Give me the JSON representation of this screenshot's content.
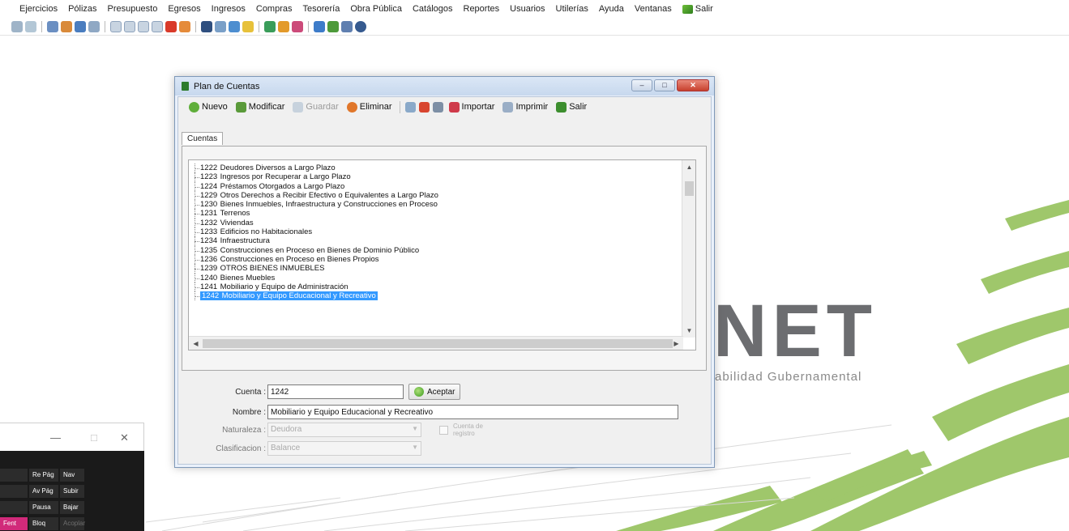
{
  "menubar": {
    "items": [
      "Ejercicios",
      "Pólizas",
      "Presupuesto",
      "Egresos",
      "Ingresos",
      "Compras",
      "Tesorería",
      "Obra Pública",
      "Catálogos",
      "Reportes",
      "Usuarios",
      "Utilerías",
      "Ayuda",
      "Ventanas"
    ],
    "exit_label": "Salir"
  },
  "background": {
    "logo_text": "NET",
    "logo_subtitle": "abilidad Gubernamental"
  },
  "dialog": {
    "title": "Plan de Cuentas",
    "toolbar": {
      "new": "Nuevo",
      "modify": "Modificar",
      "save": "Guardar",
      "delete": "Eliminar",
      "import": "Importar",
      "print": "Imprimir",
      "exit": "Salir"
    },
    "tab": "Cuentas",
    "tree": [
      {
        "code": "1222",
        "label": "Deudores Diversos a Largo Plazo"
      },
      {
        "code": "1223",
        "label": "Ingresos por Recuperar a Largo Plazo"
      },
      {
        "code": "1224",
        "label": "Préstamos Otorgados a Largo Plazo"
      },
      {
        "code": "1229",
        "label": "Otros Derechos a Recibir Efectivo o Equivalentes a Largo Plazo"
      },
      {
        "code": "1230",
        "label": "Bienes Inmuebles, Infraestructura y Construcciones en Proceso"
      },
      {
        "code": "1231",
        "label": "Terrenos"
      },
      {
        "code": "1232",
        "label": "Viviendas"
      },
      {
        "code": "1233",
        "label": "Edificios no Habitacionales"
      },
      {
        "code": "1234",
        "label": "Infraestructura"
      },
      {
        "code": "1235",
        "label": "Construcciones en Proceso en Bienes de Dominio Público"
      },
      {
        "code": "1236",
        "label": "Construcciones en Proceso en Bienes Propios"
      },
      {
        "code": "1239",
        "label": "OTROS BIENES INMUEBLES"
      },
      {
        "code": "1240",
        "label": "Bienes Muebles"
      },
      {
        "code": "1241",
        "label": "Mobiliario y Equipo de Administración"
      },
      {
        "code": "1242",
        "label": "Mobiliario y Equipo Educacional y Recreativo"
      }
    ],
    "form": {
      "cuenta_label": "Cuenta",
      "cuenta_value": "1242",
      "accept_label": "Aceptar",
      "nombre_label": "Nombre",
      "nombre_value": "Mobiliario y Equipo Educacional y Recreativo",
      "naturaleza_label": "Naturaleza",
      "naturaleza_value": "Deudora",
      "clasificacion_label": "Clasificacion",
      "clasificacion_value": "Balance",
      "registro_label_1": "Cuenta de",
      "registro_label_2": "registro"
    }
  },
  "osk": {
    "keys": [
      "Re Pág",
      "Nav",
      "Av Pág",
      "Subir",
      "Pausa",
      "Bajar",
      "Bloq Despl",
      "Acoplar",
      "Fent"
    ]
  },
  "colors": {
    "selection": "#3399ff",
    "window_frame": "#7e98b8",
    "close_button": "#c7402d"
  }
}
